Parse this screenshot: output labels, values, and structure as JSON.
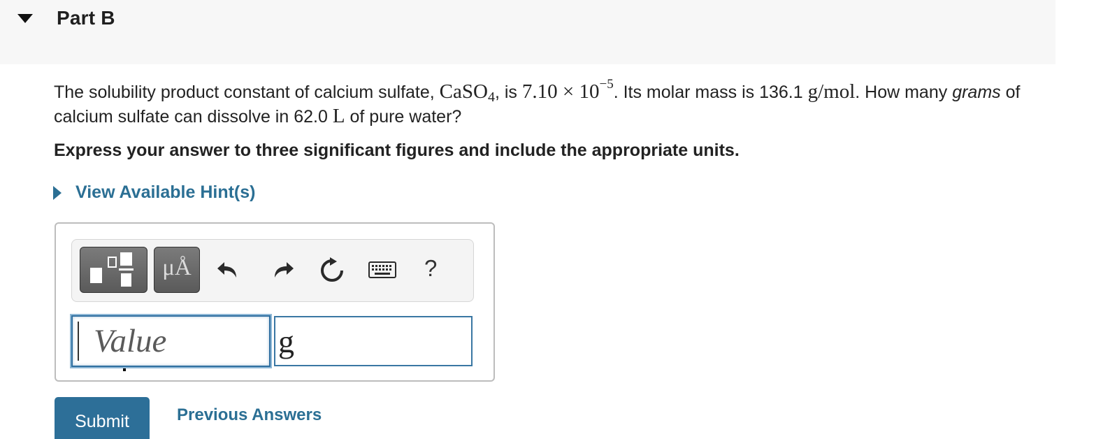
{
  "part": {
    "title": "Part B"
  },
  "question": {
    "text_1": "The solubility product constant of calcium sulfate, ",
    "formula_main": "CaSO",
    "formula_sub": "4",
    "text_2": ", is ",
    "ksp_mantissa": "7.10 × 10",
    "ksp_exponent": "−5",
    "text_3": ". Its molar mass is 136.1 ",
    "molar_unit": "g/mol",
    "text_4": ". How many ",
    "text_grams": "grams",
    "text_5": " of calcium sulfate can dissolve in 62.0 ",
    "volume_unit": "L",
    "text_6": " of pure water?"
  },
  "instruction": "Express your answer to three significant figures and include the appropriate units.",
  "hint": {
    "label": "View Available Hint(s)"
  },
  "toolbar": {
    "templates_icon": "templates-icon",
    "units_label": "μÅ",
    "undo_icon": "undo-icon",
    "redo_icon": "redo-icon",
    "reset_icon": "reset-icon",
    "keyboard_icon": "keyboard-icon",
    "help_label": "?"
  },
  "answer": {
    "value_placeholder": "Value",
    "value": "",
    "units_value": "g"
  },
  "actions": {
    "submit_label": "Submit",
    "previous_label": "Previous Answers"
  },
  "colors": {
    "accent": "#2b6f94",
    "header_bg": "#f7f7f7"
  }
}
